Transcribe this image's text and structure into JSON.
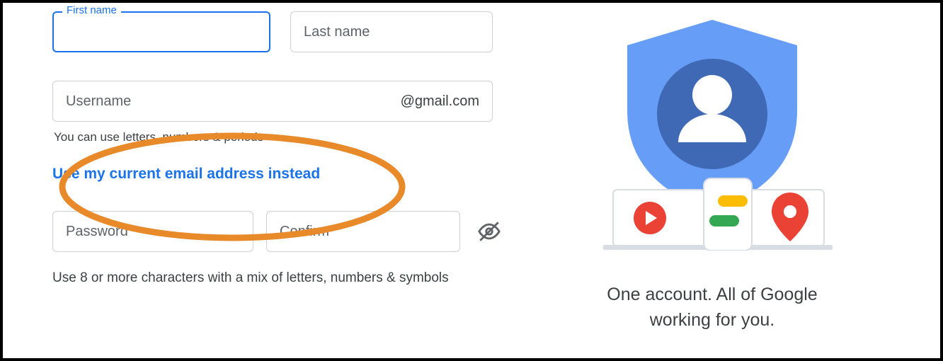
{
  "form": {
    "first_name": {
      "label": "First name",
      "value": ""
    },
    "last_name": {
      "placeholder": "Last name"
    },
    "username": {
      "placeholder": "Username",
      "suffix": "@gmail.com",
      "hint": "You can use letters, numbers & periods"
    },
    "use_current_link": "Use my current email address instead",
    "password": {
      "placeholder": "Password"
    },
    "confirm": {
      "placeholder": "Confirm"
    },
    "password_hint": "Use 8 or more characters with a mix of letters, numbers & symbols"
  },
  "right": {
    "tagline_line1": "One account. All of Google",
    "tagline_line2": "working for you."
  }
}
